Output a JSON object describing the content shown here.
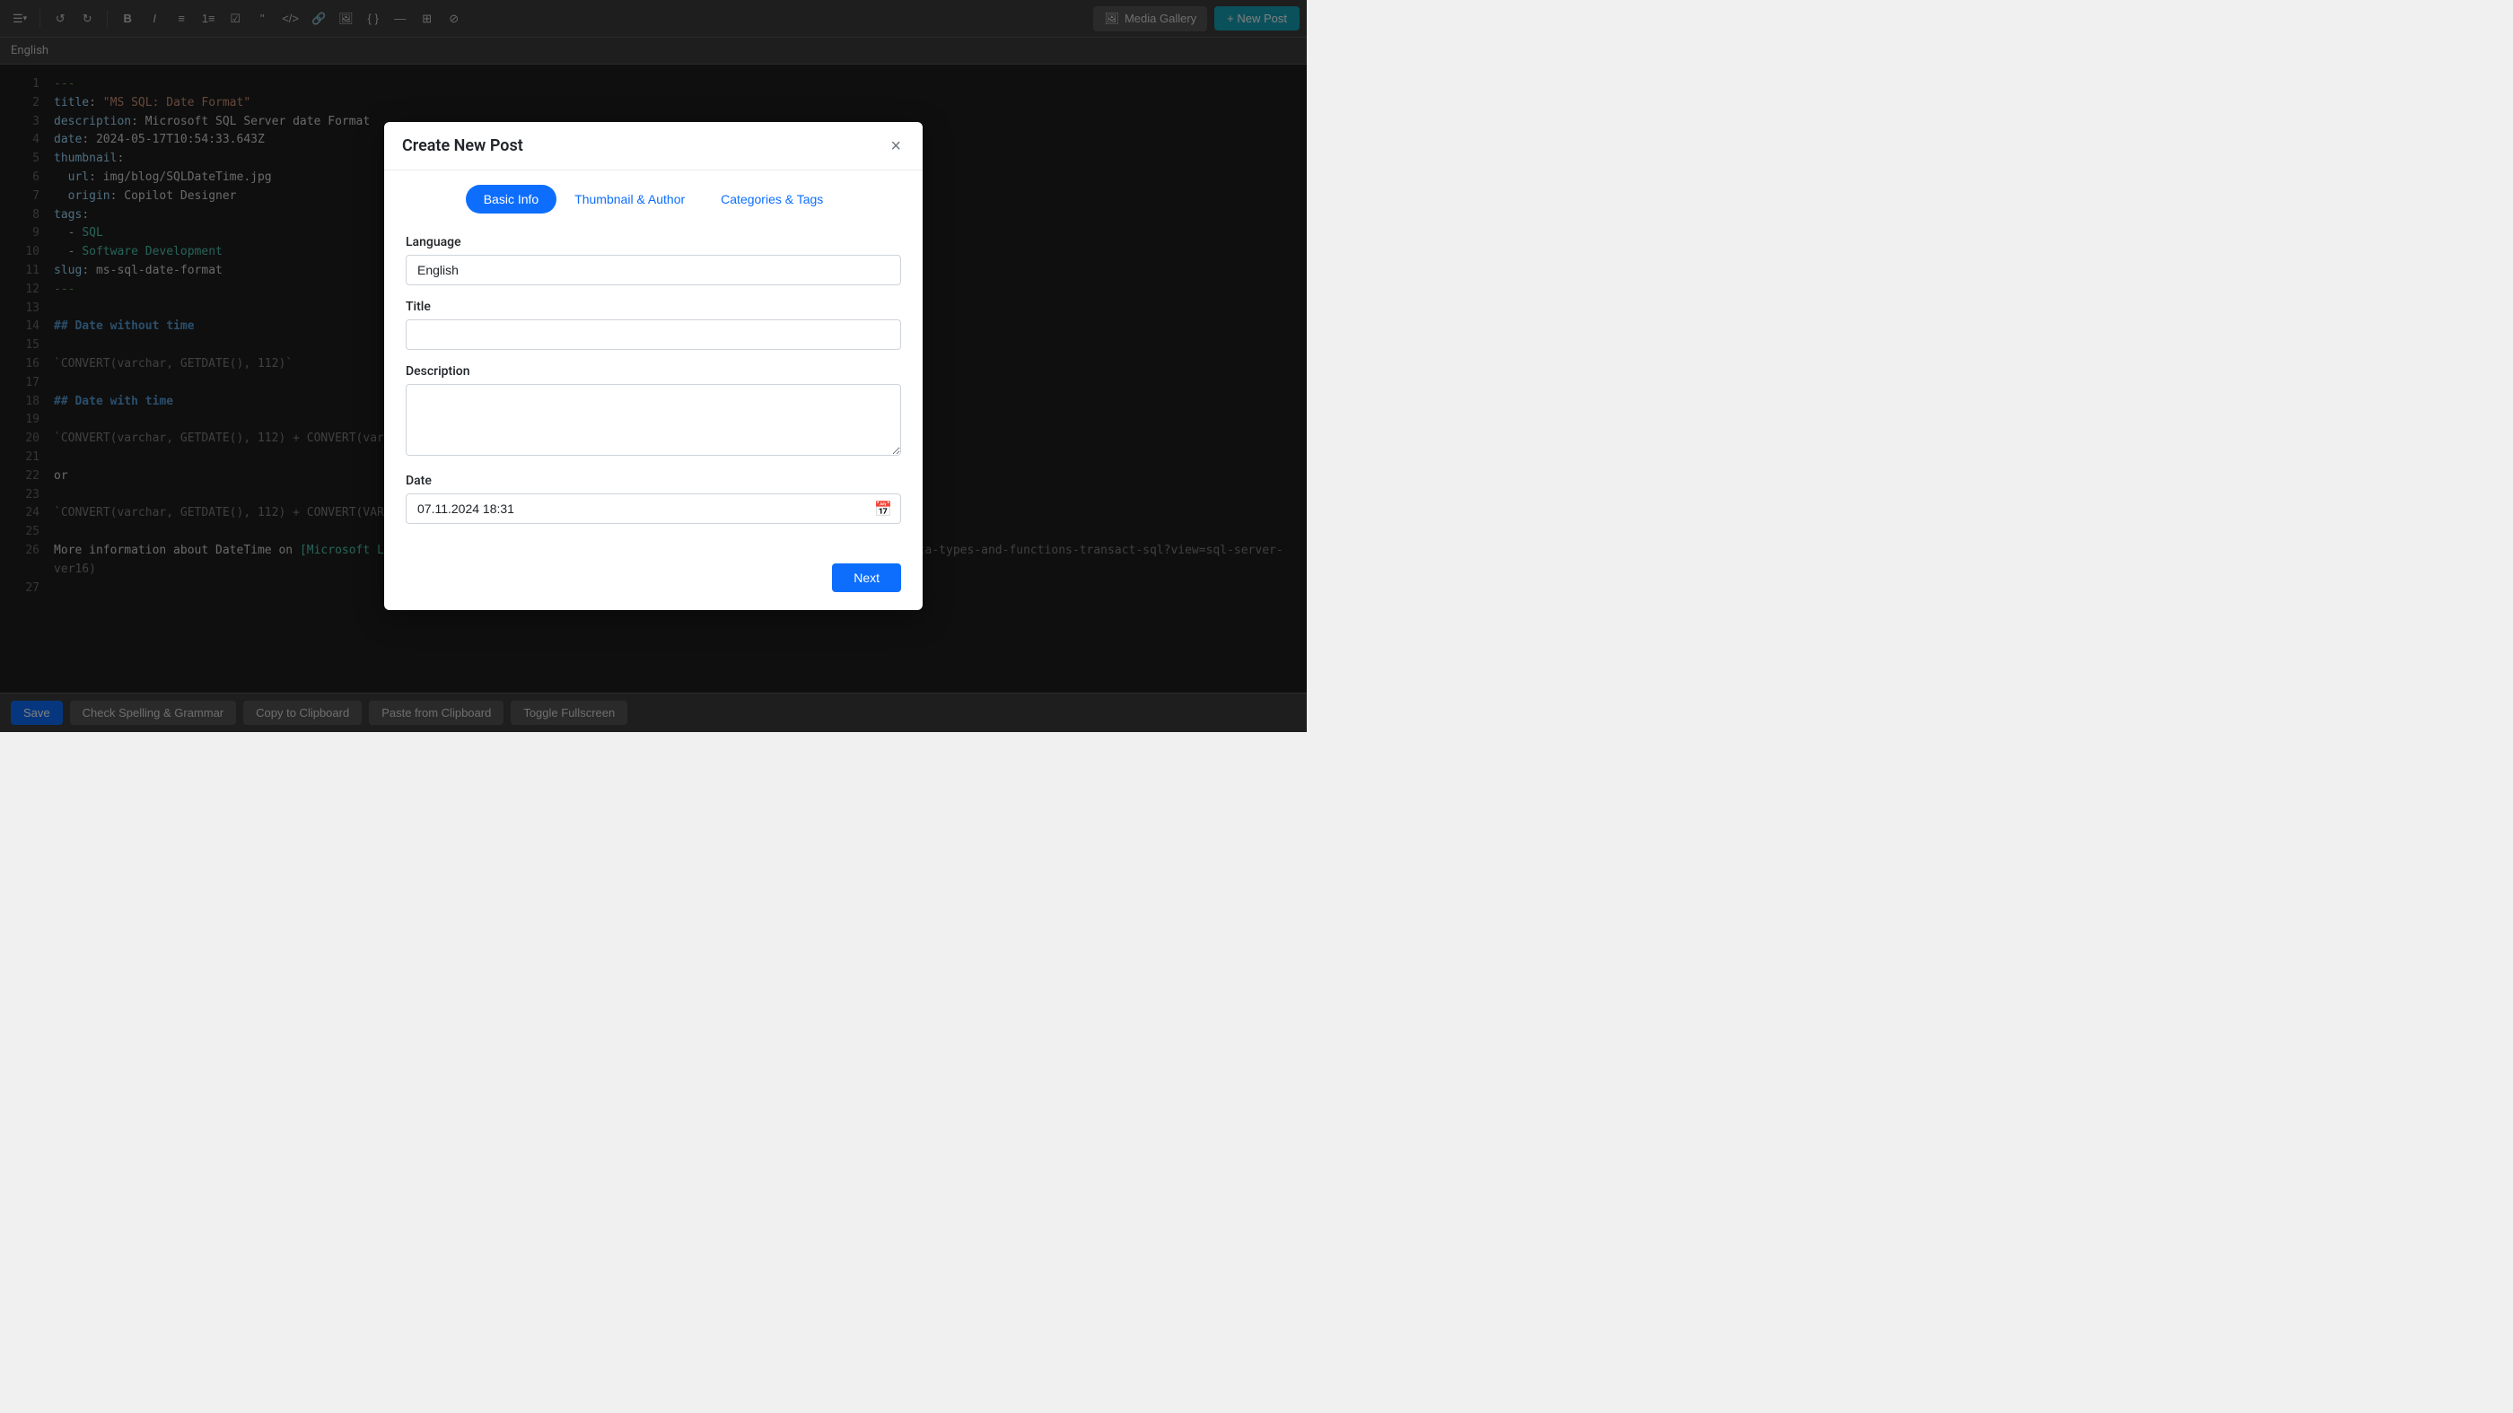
{
  "toolbar": {
    "menu_icon": "☰",
    "undo_icon": "↺",
    "redo_icon": "↻",
    "bold_icon": "B",
    "italic_icon": "I",
    "bullet_list_icon": "•≡",
    "number_list_icon": "1≡",
    "checklist_icon": "☑",
    "blockquote_icon": "❝",
    "code_icon": "</>",
    "link_icon": "🔗",
    "image_icon": "🖼",
    "code_block_icon": "{ }",
    "hr_icon": "—",
    "more_icon": "⊞",
    "clear_icon": "⊘",
    "media_gallery_label": "Media Gallery",
    "new_post_label": "+ New Post"
  },
  "language_bar": {
    "language": "English"
  },
  "editor": {
    "lines": [
      {
        "number": 1,
        "content": "---",
        "type": "comment"
      },
      {
        "number": 2,
        "content": "title: \"MS SQL: Date Format\"",
        "type": "mixed"
      },
      {
        "number": 3,
        "content": "description: Microsoft SQL Server date Format",
        "type": "mixed"
      },
      {
        "number": 4,
        "content": "date: 2024-05-17T10:54:33.643Z",
        "type": "mixed"
      },
      {
        "number": 5,
        "content": "thumbnail:",
        "type": "key"
      },
      {
        "number": 6,
        "content": "  url: img/blog/SQLDateTime.jpg",
        "type": "mixed"
      },
      {
        "number": 7,
        "content": "  origin: Copilot Designer",
        "type": "mixed"
      },
      {
        "number": 8,
        "content": "tags:",
        "type": "key"
      },
      {
        "number": 9,
        "content": "  - SQL",
        "type": "tag"
      },
      {
        "number": 10,
        "content": "  - Software Development",
        "type": "tag"
      },
      {
        "number": 11,
        "content": "slug: ms-sql-date-format",
        "type": "mixed"
      },
      {
        "number": 12,
        "content": "---",
        "type": "comment"
      },
      {
        "number": 13,
        "content": "",
        "type": "normal"
      },
      {
        "number": 14,
        "content": "## Date without time",
        "type": "heading"
      },
      {
        "number": 15,
        "content": "",
        "type": "normal"
      },
      {
        "number": 16,
        "content": "`CONVERT(varchar, GETDATE(), 112)`",
        "type": "code"
      },
      {
        "number": 17,
        "content": "",
        "type": "normal"
      },
      {
        "number": 18,
        "content": "## Date with time",
        "type": "heading"
      },
      {
        "number": 19,
        "content": "",
        "type": "normal"
      },
      {
        "number": 20,
        "content": "`CONVERT(varchar, GETDATE(), 112) + CONVERT(varchar, GET",
        "type": "code"
      },
      {
        "number": 21,
        "content": "",
        "type": "normal"
      },
      {
        "number": 22,
        "content": "or",
        "type": "keyword"
      },
      {
        "number": 23,
        "content": "",
        "type": "normal"
      },
      {
        "number": 24,
        "content": "`CONVERT(varchar, GETDATE(), 112) + CONVERT(VARCHAR, DATEPART(hh, GetDate())) + CONVERT(VARCHAR, DATEPART(mi, GetDate()))`",
        "type": "code"
      },
      {
        "number": 25,
        "content": "",
        "type": "normal"
      },
      {
        "number": 26,
        "content": "More information about DateTime on [Microsoft Learn](https://learn.microsoft.com/en-us/sql/t-sql/functions/date-and-time-data-types-and-functions-transact-sql?view=sql-server-ver16)",
        "type": "link"
      },
      {
        "number": 27,
        "content": "",
        "type": "normal"
      }
    ]
  },
  "bottom_bar": {
    "save_label": "Save",
    "check_spelling_label": "Check Spelling & Grammar",
    "copy_clipboard_label": "Copy to Clipboard",
    "paste_clipboard_label": "Paste from Clipboard",
    "toggle_fullscreen_label": "Toggle Fullscreen"
  },
  "modal": {
    "title": "Create New Post",
    "close_icon": "×",
    "tabs": [
      {
        "label": "Basic Info",
        "active": true
      },
      {
        "label": "Thumbnail & Author",
        "active": false
      },
      {
        "label": "Categories & Tags",
        "active": false
      }
    ],
    "form": {
      "language_label": "Language",
      "language_value": "English",
      "language_placeholder": "English",
      "title_label": "Title",
      "title_value": "",
      "title_placeholder": "",
      "description_label": "Description",
      "description_value": "",
      "description_placeholder": "",
      "date_label": "Date",
      "date_value": "07.11.2024 18:31",
      "date_placeholder": "07.11.2024 18:31",
      "calendar_icon": "📅"
    },
    "next_button_label": "Next"
  }
}
